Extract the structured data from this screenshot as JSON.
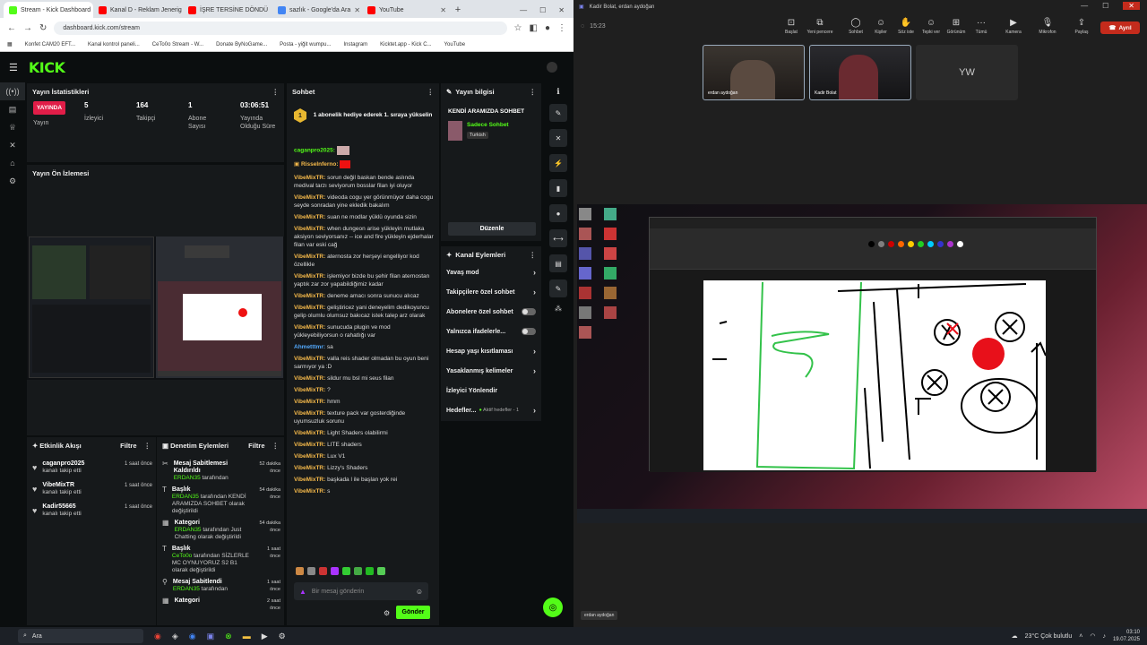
{
  "browser": {
    "tabs": [
      {
        "label": "Stream - Kick Dashboard",
        "color": "#53fc18"
      },
      {
        "label": "Kanal D - Reklam Jenerig",
        "color": "#ff0000"
      },
      {
        "label": "İŞRE TERSİNE DÖNDÜ",
        "color": "#ff0000"
      },
      {
        "label": "sazlık - Google'da Ara",
        "color": "#4285f4"
      },
      {
        "label": "YouTube",
        "color": "#ff0000"
      }
    ],
    "url": "dashboard.kick.com/stream",
    "bookmarks": [
      "Konfet CAM20 EFT...",
      "Kanal kontrol paneli...",
      "CeTo0o Stream - W...",
      "Donate ByNoGame...",
      "Posta - yiğit wumpu...",
      "Instagram",
      "Kicktet.app - Kick C...",
      "YouTube"
    ]
  },
  "kick": {
    "logo": "KICK",
    "stats_panel": {
      "title": "Yayın İstatistikleri",
      "live_badge": "YAYINDA",
      "live_label": "Yayın",
      "viewers": {
        "value": "5",
        "label": "İzleyici"
      },
      "followers": {
        "value": "164",
        "label": "Takipçi"
      },
      "subs": {
        "value": "1",
        "label": "Abone Sayısı"
      },
      "uptime": {
        "value": "03:06:51",
        "label": "Yayında Olduğu Süre"
      }
    },
    "preview_title": "Yayın Ön İzlemesi",
    "activity": {
      "title": "Etkinlik Akışı",
      "filter": "Filtre",
      "items": [
        {
          "user": "caganpro2025",
          "text": "kanalı takip etti",
          "time": "1 saat önce"
        },
        {
          "user": "VibeMixTR",
          "text": "kanalı takip etti",
          "time": "1 saat önce"
        },
        {
          "user": "Kadir55665",
          "text": "kanalı takip etti",
          "time": "1 saat önce"
        }
      ]
    },
    "audit": {
      "title": "Denetim Eylemleri",
      "filter": "Filtre",
      "items": [
        {
          "title": "Mesaj Sabitlemesi Kaldırıldı",
          "actor": "ERDAN35",
          "detail": "tarafından",
          "time": "52 dakika önce"
        },
        {
          "title": "Başlık",
          "actor": "ERDAN35",
          "detail": "tarafından KENDİ ARAMIZDA SOHBET olarak değiştirildi",
          "time": "54 dakika önce"
        },
        {
          "title": "Kategori",
          "actor": "ERDAN35",
          "detail": "tarafından Just Chatting olarak değiştirildi",
          "time": "54 dakika önce"
        },
        {
          "title": "Başlık",
          "actor": "CeTo0o",
          "detail": "tarafından SİZLERLE MC OYNUYORUZ S2 B1 olarak değiştirildi",
          "time": "1 saat önce"
        },
        {
          "title": "Mesaj Sabitlendi",
          "actor": "ERDAN35",
          "detail": "tarafından",
          "time": "1 saat önce"
        },
        {
          "title": "Kategori",
          "actor": "",
          "detail": "",
          "time": "2 saat önce"
        }
      ]
    },
    "chat": {
      "title": "Sohbet",
      "pinned": "1 abonelik hediye ederek 1. sıraya yükselin",
      "messages": [
        {
          "user": "caganpro2025:",
          "text": ""
        },
        {
          "user": "RisseInferno:",
          "text": ""
        },
        {
          "user": "VibeMixTR:",
          "text": "sorun değil baskan bende aslında medival tarzı seviyorum bosslar filan iyi oluyor"
        },
        {
          "user": "VibeMixTR:",
          "text": "videoda cogu yer görünmüyor daha cogu seyde sonradan yine ekledik bakalım"
        },
        {
          "user": "VibeMixTR:",
          "text": "suan ne modlar yüklü oyunda sizin"
        },
        {
          "user": "VibeMixTR:",
          "text": "when dungeon arise yükleyin mutlaka aksiyon seviyorsanız -- ice and fire yükleyin ejderhalar filan var eski cağ"
        },
        {
          "user": "VibeMixTR:",
          "text": "aternosta zor herşeyi engelliyor kod özellikle"
        },
        {
          "user": "VibeMixTR:",
          "text": "işlemiyor bizde bu şehir filan aternostan yaptık zar zor yapabildiğimiz kadar"
        },
        {
          "user": "VibeMixTR:",
          "text": "deneme amacı sonra sunucu alıcaz"
        },
        {
          "user": "VibeMixTR:",
          "text": "geliştiricez yani deneyelim dedikoyuncu gelip olumlu olumsuz bakıcaz istek talep arz olarak"
        },
        {
          "user": "VibeMixTR:",
          "text": "sunucuda plugin ve mod yükleyebiliyorsun o rahatlığı var"
        },
        {
          "user": "Ahmetttmr:",
          "text": "sa"
        },
        {
          "user": "VibeMixTR:",
          "text": "valla reis shader olmadan bu oyun beni sarmıyor ya :D"
        },
        {
          "user": "VibeMixTR:",
          "text": "sildur mu bsl mi seus filan"
        },
        {
          "user": "VibeMixTR:",
          "text": "?"
        },
        {
          "user": "VibeMixTR:",
          "text": "hmm"
        },
        {
          "user": "VibeMixTR:",
          "text": "texture pack var gosterdiğinde uyumsuzluk sorunu"
        },
        {
          "user": "VibeMixTR:",
          "text": "Light Shaders olabilirmi"
        },
        {
          "user": "VibeMixTR:",
          "text": "LITE shaders"
        },
        {
          "user": "VibeMixTR:",
          "text": "Lux V1"
        },
        {
          "user": "VibeMixTR:",
          "text": "Lizzy's Shaders"
        },
        {
          "user": "VibeMixTR:",
          "text": "başkada l ile başlan yok rei"
        },
        {
          "user": "VibeMixTR:",
          "text": "s"
        }
      ],
      "input_placeholder": "Bir mesaj gönderin",
      "send": "Gönder"
    },
    "stream_info": {
      "title": "Yayın bilgisi",
      "stream_title": "KENDİ ARAMIZDA SOHBET",
      "category": "Sadece Sohbet",
      "language": "Turkish",
      "edit": "Düzenle"
    },
    "channel_actions": {
      "title": "Kanal Eylemleri",
      "items": [
        {
          "label": "Yavaş mod",
          "type": "chevron"
        },
        {
          "label": "Takipçilere özel sohbet",
          "type": "chevron"
        },
        {
          "label": "Abonelere özel sohbet",
          "type": "toggle"
        },
        {
          "label": "Yalnızca ifadelerle...",
          "type": "toggle"
        },
        {
          "label": "Hesap yaşı kısıtlaması",
          "type": "chevron"
        },
        {
          "label": "Yasaklanmış kelimeler",
          "type": "chevron"
        },
        {
          "label": "İzleyici Yönlendir",
          "type": "none"
        },
        {
          "label": "Hedefler...",
          "type": "chevron",
          "extra": "Aktif hedefler - 1"
        }
      ]
    }
  },
  "teams": {
    "title": "Kadir Bolat, erdan aydoğan",
    "timer": "15:23",
    "toolbar": [
      "Başlat",
      "Yeni pencere",
      "Sohbet",
      "Kişiler",
      "Söz iste",
      "Tepki ver",
      "Görünüm",
      "Tümü",
      "Kamera",
      "Mikrofon",
      "Paylaş"
    ],
    "leave": "Ayrıl",
    "participants": [
      {
        "name": "erdan aydoğan"
      },
      {
        "name": "Kadir Bolat"
      },
      {
        "name": "YW",
        "initials": "YW"
      }
    ],
    "share_label": "erdan aydoğan"
  },
  "taskbar": {
    "search": "Ara",
    "weather": "23°C  Çok bulutlu",
    "time": "03:10",
    "date": "19.07.2025"
  }
}
